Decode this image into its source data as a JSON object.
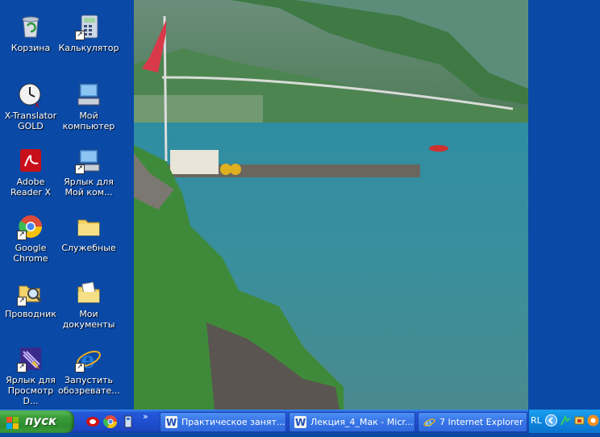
{
  "desktop": {
    "icons": [
      {
        "label": "Корзина",
        "icon": "recycle-bin-icon",
        "shortcut": false
      },
      {
        "label": "Калькулятор",
        "icon": "calculator-icon",
        "shortcut": true
      },
      {
        "label": "X-Translator GOLD",
        "icon": "x-translator-icon",
        "shortcut": false
      },
      {
        "label": "Мой компьютер",
        "icon": "my-computer-icon",
        "shortcut": false
      },
      {
        "label": "Adobe Reader X",
        "icon": "adobe-reader-icon",
        "shortcut": false
      },
      {
        "label": "Ярлык для Мой ком...",
        "icon": "my-computer-shortcut-icon",
        "shortcut": true
      },
      {
        "label": "Google Chrome",
        "icon": "chrome-icon",
        "shortcut": true
      },
      {
        "label": "Служебные",
        "icon": "folder-icon",
        "shortcut": false
      },
      {
        "label": "Проводник",
        "icon": "explorer-icon",
        "shortcut": true
      },
      {
        "label": "Мои документы",
        "icon": "my-documents-icon",
        "shortcut": false
      },
      {
        "label": "Ярлык для Просмотр D...",
        "icon": "viewer-shortcut-icon",
        "shortcut": true
      },
      {
        "label": "Запустить обозревате...",
        "icon": "internet-explorer-icon",
        "shortcut": true
      }
    ]
  },
  "taskbar": {
    "start_label": "пуск",
    "overflow_chevron": "»",
    "tasks": [
      {
        "label": "Практическое занят...",
        "icon": "word-icon"
      },
      {
        "label": "Лекция_4_Мак - Micr...",
        "icon": "word-icon"
      },
      {
        "label": "7 Internet Explorer",
        "icon": "internet-explorer-icon"
      }
    ],
    "tray": {
      "language": "RL"
    }
  }
}
